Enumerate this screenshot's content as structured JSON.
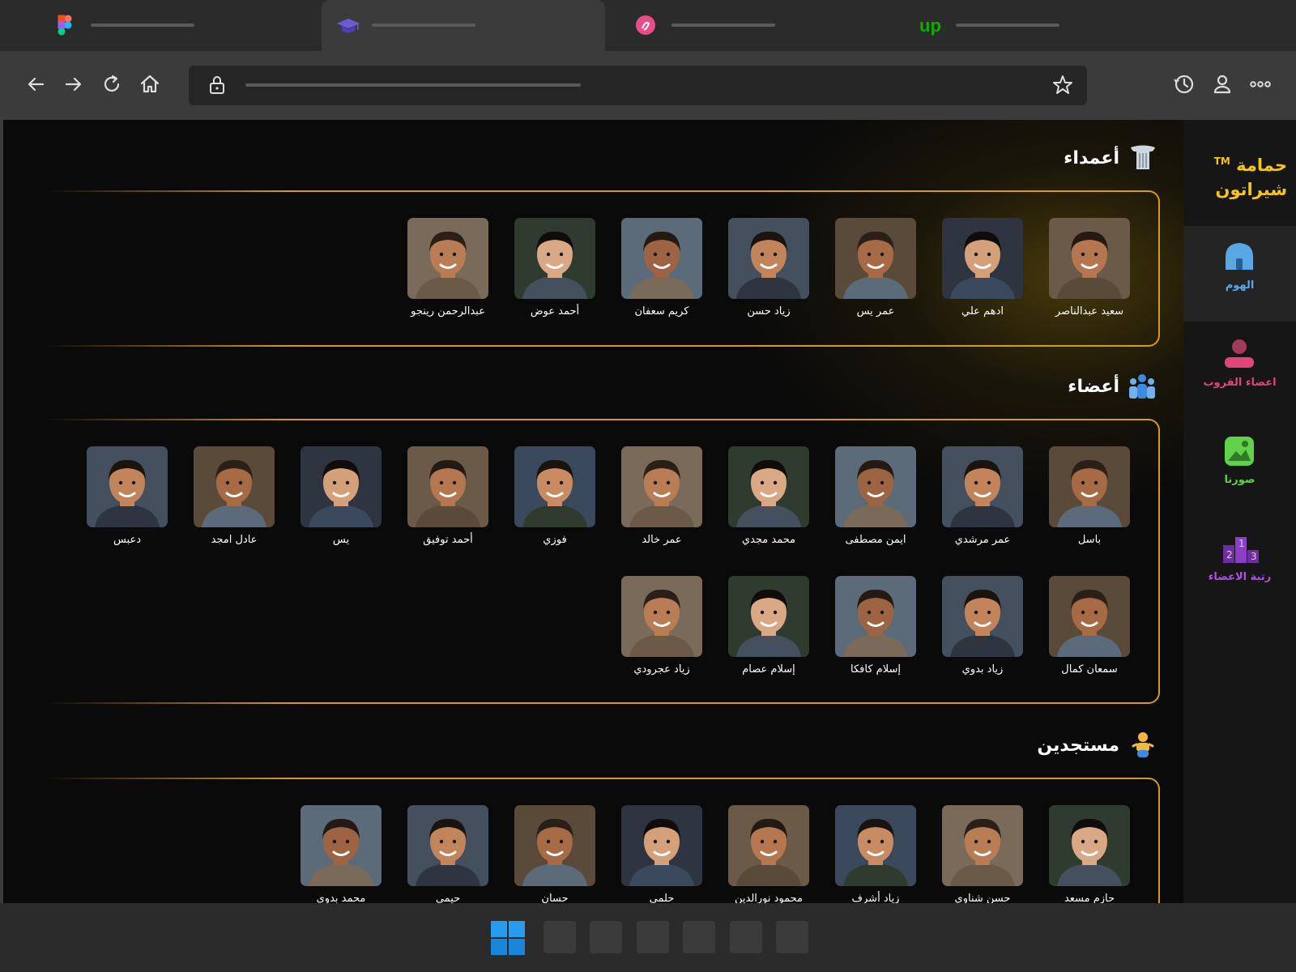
{
  "browser": {
    "tabs": [
      {
        "icon": "figma-icon"
      },
      {
        "icon": "graduation-cap-icon",
        "active": true
      },
      {
        "icon": "pink-circle-icon"
      },
      {
        "icon": "upwork-icon"
      }
    ],
    "toolbar_icons": [
      "back-arrow-icon",
      "forward-arrow-icon",
      "reload-icon",
      "home-icon",
      "lock-icon",
      "star-icon",
      "history-icon",
      "profile-icon",
      "more-icon"
    ]
  },
  "sidebar": {
    "brand_line1": "حمامة",
    "brand_tm": "TM",
    "brand_line2": "شيراتون",
    "items": [
      {
        "label": "الهوم",
        "color": "#5aa7e6"
      },
      {
        "label": "اعضاء القروب",
        "color": "#e0457b"
      },
      {
        "label": "صورنا",
        "color": "#5fd14a"
      },
      {
        "label": "رتبة الاعضاء",
        "color": "#b04fe6"
      }
    ]
  },
  "sections": {
    "leaders": {
      "title": "أعمداء",
      "members": [
        "سعيد عبدالناصر",
        "ادهم علي",
        "عمر يس",
        "زياد حسن",
        "كريم سعفان",
        "أحمد عوض",
        "عبدالرحمن رينجو"
      ]
    },
    "members": {
      "title": "أعضاء",
      "row1": [
        "باسل",
        "عمر مرشدي",
        "ايمن مصطفى",
        "محمد مجدي",
        "عمر خالد",
        "فوزي",
        "أحمد توفيق",
        "يس",
        "عادل امجد",
        "دعبس"
      ],
      "row2": [
        "سمعان كمال",
        "زياد بدوي",
        "إسلام كافكا",
        "إسلام عصام",
        "زياد عجرودي"
      ]
    },
    "newcomers": {
      "title": "مستجدين",
      "members": [
        "حازم مسعد",
        "حسن شناوي",
        "زياد أشرف",
        "محمود نورالدين",
        "حلمي",
        "حسان",
        "حيمي",
        "محمد بدوي"
      ]
    }
  },
  "colors": {
    "accent_gold": "#f5c518",
    "section_border": "#d99a1a"
  }
}
